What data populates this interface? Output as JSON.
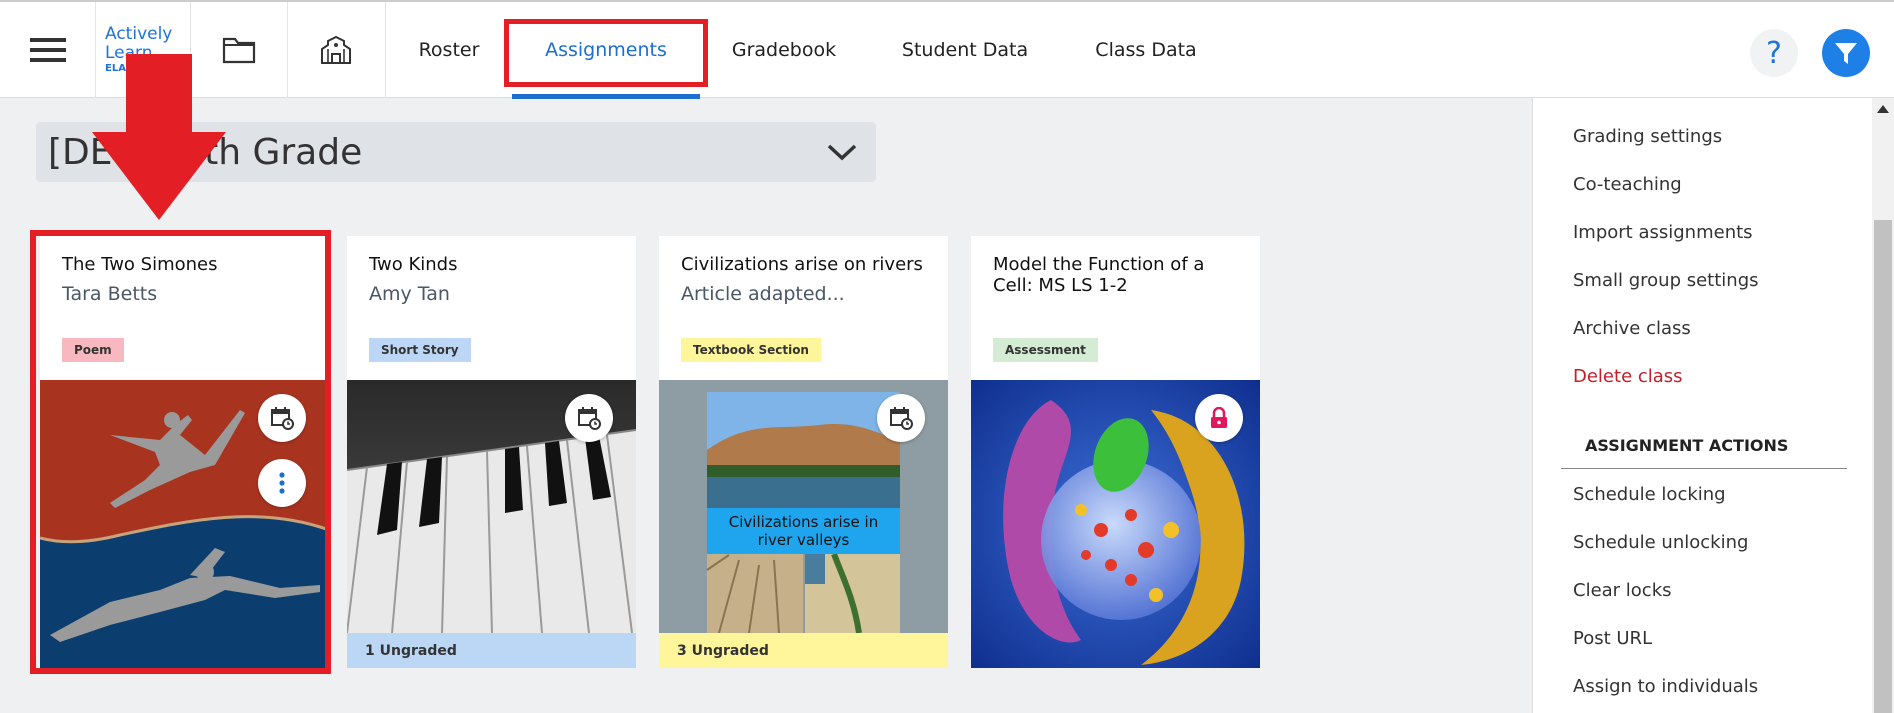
{
  "app": {
    "logo_line1": "Actively",
    "logo_line2": "Learn",
    "logo_sub": "ELA"
  },
  "nav": {
    "tabs": [
      {
        "label": "Roster",
        "active": false
      },
      {
        "label": "Assignments",
        "active": true
      },
      {
        "label": "Gradebook",
        "active": false
      },
      {
        "label": "Student Data",
        "active": false
      },
      {
        "label": "Class Data",
        "active": false
      }
    ],
    "help_label": "?"
  },
  "class_selector": {
    "value": "[DE... 10th Grade"
  },
  "cards": [
    {
      "title": "The Two Simones",
      "author": "Tara Betts",
      "badge": "Poem",
      "badge_color": "#f7b9bf",
      "footer": ""
    },
    {
      "title": "Two Kinds",
      "author": "Amy Tan",
      "badge": "Short Story",
      "badge_color": "#bcd7f5",
      "footer": "1 Ungraded"
    },
    {
      "title": "Civilizations arise on rivers",
      "author": "Article adapted...",
      "badge": "Textbook Section",
      "badge_color": "#fff59a",
      "footer": "3 Ungraded",
      "image_caption": "Civilizations arise in river valleys"
    },
    {
      "title": "Model the Function of a Cell: MS LS 1-2",
      "author": "",
      "badge": "Assessment",
      "badge_color": "#d3ecd3",
      "footer": ""
    }
  ],
  "side_panel": {
    "items": [
      {
        "label": "Grading settings"
      },
      {
        "label": "Co-teaching"
      },
      {
        "label": "Import assignments"
      },
      {
        "label": "Small group settings"
      },
      {
        "label": "Archive class"
      },
      {
        "label": "Delete class"
      }
    ],
    "assignment_actions_heading": "ASSIGNMENT ACTIONS",
    "actions": [
      {
        "label": "Schedule locking"
      },
      {
        "label": "Schedule unlocking"
      },
      {
        "label": "Clear locks"
      },
      {
        "label": "Post URL"
      },
      {
        "label": "Assign to individuals"
      }
    ]
  },
  "colors": {
    "accent": "#1c6fd1",
    "highlight_red": "#e31e24",
    "danger": "#c0202a",
    "ungraded_blue": "#bcd7f5",
    "ungraded_yellow": "#fff59a"
  }
}
